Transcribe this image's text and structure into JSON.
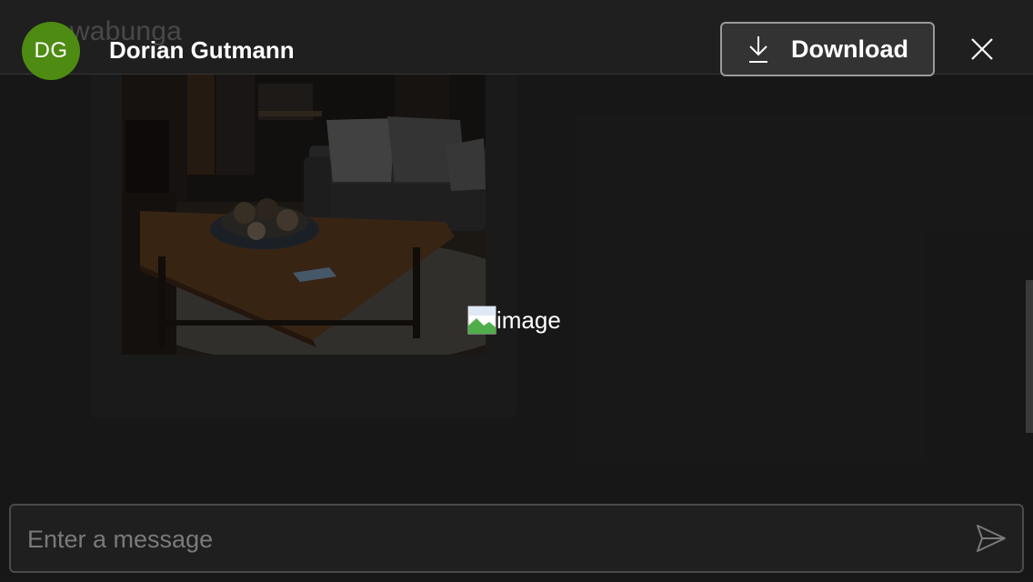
{
  "chat": {
    "behind_title": "owabunga"
  },
  "viewer": {
    "avatar_initials": "DG",
    "avatar_color": "#4e8b12",
    "sender_name": "Dorian Gutmann",
    "download_label": "Download",
    "download_icon": "download-icon",
    "close_icon": "close-icon"
  },
  "image": {
    "alt_text": "image",
    "broken_icon": "broken-image-icon"
  },
  "composer": {
    "placeholder": "Enter a message",
    "value": "",
    "send_icon": "send-icon"
  },
  "colors": {
    "background": "#262626",
    "accent": "#4e8b12"
  }
}
